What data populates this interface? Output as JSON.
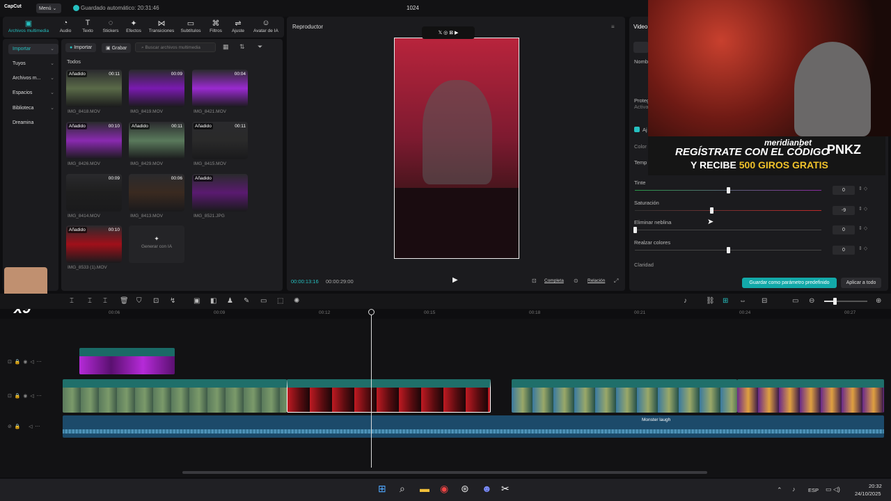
{
  "topbar": {
    "logo": "CapCut",
    "menu": "Menú",
    "autosave": "Guardado automático: 20:31:46",
    "title": "1024"
  },
  "tabs": [
    {
      "label": "Archivos multimedia",
      "icon": "media-icon"
    },
    {
      "label": "Audio",
      "icon": "audio-icon"
    },
    {
      "label": "Texto",
      "icon": "text-icon"
    },
    {
      "label": "Stickers",
      "icon": "sticker-icon"
    },
    {
      "label": "Efectos",
      "icon": "effects-icon"
    },
    {
      "label": "Transiciones",
      "icon": "transitions-icon"
    },
    {
      "label": "Subtítulos",
      "icon": "subtitles-icon"
    },
    {
      "label": "Filtros",
      "icon": "filters-icon"
    },
    {
      "label": "Ajuste",
      "icon": "adjust-icon"
    },
    {
      "label": "Avatar de IA",
      "icon": "avatar-icon"
    }
  ],
  "sidebar": [
    "Importar",
    "Tuyos",
    "Archivos m...",
    "Espacios",
    "Biblioteca",
    "Dreamina"
  ],
  "media": {
    "import": "Importar",
    "record": "Grabar",
    "search_placeholder": "Buscar archivos multimedia",
    "section": "Todos",
    "added_label": "Añadido",
    "generate": "Generar con IA",
    "items": [
      {
        "name": "IMG_8418.MOV",
        "dur": "00:11",
        "added": true
      },
      {
        "name": "IMG_8419.MOV",
        "dur": "00:09",
        "added": false
      },
      {
        "name": "IMG_8421.MOV",
        "dur": "00:04",
        "added": false
      },
      {
        "name": "IMG_8426.MOV",
        "dur": "00:10",
        "added": true
      },
      {
        "name": "IMG_8429.MOV",
        "dur": "00:11",
        "added": true
      },
      {
        "name": "IMG_8415.MOV",
        "dur": "00:11",
        "added": true
      },
      {
        "name": "IMG_8414.MOV",
        "dur": "00:09",
        "added": false
      },
      {
        "name": "IMG_8413.MOV",
        "dur": "00:06",
        "added": false
      },
      {
        "name": "IMG_8521.JPG",
        "dur": "",
        "added": true
      },
      {
        "name": "IMG_8533 (1).MOV",
        "dur": "00:10",
        "added": true
      }
    ]
  },
  "player": {
    "title": "Reproductor",
    "current": "00:00:13:16",
    "total": "00:00:29:00",
    "full": "Completa",
    "ratio": "Relación"
  },
  "inspector": {
    "tab": "Video",
    "name_label": "Nomb",
    "protect_label": "Proteg",
    "protect_sub": "Activa",
    "adjust_label": "Aj",
    "color_label": "Color",
    "temp_label": "Temp",
    "rows": [
      {
        "label": "Tinte",
        "value": "0",
        "pos": 0.5
      },
      {
        "label": "Saturación",
        "value": "-9",
        "pos": 0.41
      },
      {
        "label": "Eliminar neblina",
        "value": "0",
        "pos": 0
      },
      {
        "label": "Realzar colores",
        "value": "0",
        "pos": 0.5
      }
    ],
    "clarity": "Claridad",
    "save_preset": "Guardar como parámetro predefinido",
    "apply_all": "Aplicar a todo"
  },
  "ad": {
    "brand": "meridianbet",
    "line1": "REGÍSTRATE CON EL CÓDIGO",
    "code": "PNKZ",
    "line2a": "Y RECIBE ",
    "line2b": "500 GIROS GRATIS"
  },
  "ruler": [
    "00:06",
    "00:09",
    "00:12",
    "00:15",
    "00:18",
    "00:21",
    "00:24",
    "00:27"
  ],
  "clips": {
    "overlay": "IMG_8426.MOV   00:00:02:22",
    "c1": "IMG_8418.MOV   00:00:02:25",
    "c1b": "Velocidad 0.5X  IMG_8418",
    "c2": "IMG_8533 (1).MOV   00:00:05:24",
    "c3": "IMG_8429.MOV   00:00:03:10",
    "c3b": "Velocidad 0.5X  IMG_8429.MOV   00:00",
    "c4": "IMG_8521.JPG   00:00:05:00",
    "audio": "Monster laugh"
  },
  "taskbar": {
    "lang": "ESP",
    "time": "20:32",
    "date": "24/10/2025"
  },
  "emote": "x9",
  "colors": {
    "accent": "#26c0c0"
  }
}
